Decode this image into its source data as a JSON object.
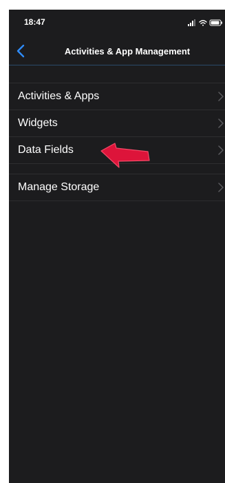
{
  "status_bar": {
    "time": "18:47",
    "icons": [
      "signal-icon",
      "wifi-icon",
      "battery-icon"
    ]
  },
  "nav": {
    "title": "Activities & App Management",
    "back_icon": "chevron-left-icon"
  },
  "groups": [
    {
      "items": [
        {
          "label": "Activities & Apps",
          "icon": "chevron-right-icon"
        },
        {
          "label": "Widgets",
          "icon": "chevron-right-icon"
        },
        {
          "label": "Data Fields",
          "icon": "chevron-right-icon"
        }
      ]
    },
    {
      "items": [
        {
          "label": "Manage Storage",
          "icon": "chevron-right-icon"
        }
      ]
    }
  ],
  "annotation": {
    "icon": "red-arrow-icon",
    "color": "#e8143c"
  },
  "colors": {
    "background": "#1c1c1e",
    "accent": "#2f8cff",
    "separator": "#2e2e30"
  }
}
